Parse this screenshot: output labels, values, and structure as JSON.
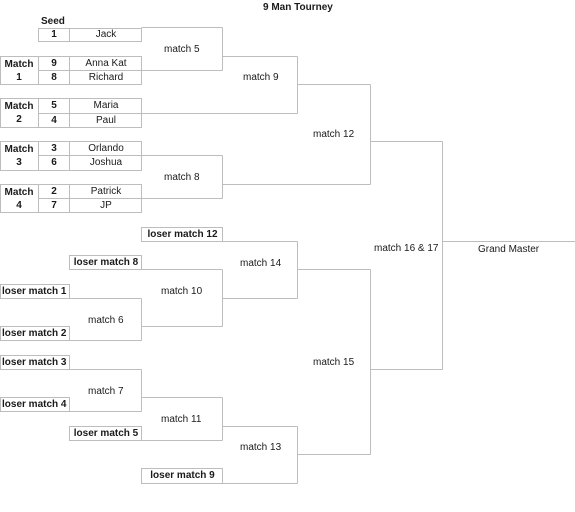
{
  "title": "9 Man Tourney",
  "seed_header": "Seed",
  "winners_bracket": {
    "bye": {
      "seed": "1",
      "name": "Jack"
    },
    "first_round": [
      {
        "label": "Match",
        "number": "1",
        "players": [
          {
            "seed": "9",
            "name": "Anna Kat"
          },
          {
            "seed": "8",
            "name": "Richard"
          }
        ]
      },
      {
        "label": "Match",
        "number": "2",
        "players": [
          {
            "seed": "5",
            "name": "Maria"
          },
          {
            "seed": "4",
            "name": "Paul"
          }
        ]
      },
      {
        "label": "Match",
        "number": "3",
        "players": [
          {
            "seed": "3",
            "name": "Orlando"
          },
          {
            "seed": "6",
            "name": "Joshua"
          }
        ]
      },
      {
        "label": "Match",
        "number": "4",
        "players": [
          {
            "seed": "2",
            "name": "Patrick"
          },
          {
            "seed": "7",
            "name": "JP"
          }
        ]
      }
    ],
    "matches": {
      "m5": "match 5",
      "m8": "match 8",
      "m9": "match 9",
      "m12": "match 12"
    }
  },
  "losers_bracket": {
    "entries": {
      "l12": "loser match 12",
      "l8": "loser match 8",
      "l1": "loser match 1",
      "l2": "loser match 2",
      "l3": "loser match 3",
      "l4": "loser match 4",
      "l5": "loser match 5",
      "l9": "loser match 9"
    },
    "matches": {
      "m6": "match 6",
      "m7": "match 7",
      "m10": "match 10",
      "m11": "match 11",
      "m13": "match 13",
      "m14": "match 14",
      "m15": "match 15"
    }
  },
  "finals": {
    "match": "match 16 & 17",
    "champion": "Grand Master"
  }
}
